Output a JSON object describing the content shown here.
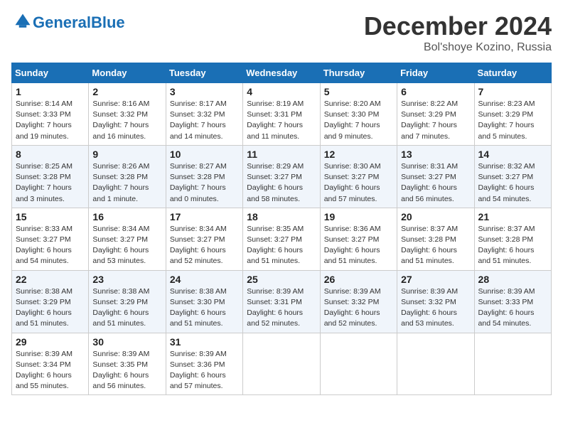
{
  "header": {
    "logo_text_general": "General",
    "logo_text_blue": "Blue",
    "month": "December 2024",
    "location": "Bol'shoye Kozino, Russia"
  },
  "days_of_week": [
    "Sunday",
    "Monday",
    "Tuesday",
    "Wednesday",
    "Thursday",
    "Friday",
    "Saturday"
  ],
  "weeks": [
    [
      {
        "day": "1",
        "sunrise": "Sunrise: 8:14 AM",
        "sunset": "Sunset: 3:33 PM",
        "daylight": "Daylight: 7 hours and 19 minutes."
      },
      {
        "day": "2",
        "sunrise": "Sunrise: 8:16 AM",
        "sunset": "Sunset: 3:32 PM",
        "daylight": "Daylight: 7 hours and 16 minutes."
      },
      {
        "day": "3",
        "sunrise": "Sunrise: 8:17 AM",
        "sunset": "Sunset: 3:32 PM",
        "daylight": "Daylight: 7 hours and 14 minutes."
      },
      {
        "day": "4",
        "sunrise": "Sunrise: 8:19 AM",
        "sunset": "Sunset: 3:31 PM",
        "daylight": "Daylight: 7 hours and 11 minutes."
      },
      {
        "day": "5",
        "sunrise": "Sunrise: 8:20 AM",
        "sunset": "Sunset: 3:30 PM",
        "daylight": "Daylight: 7 hours and 9 minutes."
      },
      {
        "day": "6",
        "sunrise": "Sunrise: 8:22 AM",
        "sunset": "Sunset: 3:29 PM",
        "daylight": "Daylight: 7 hours and 7 minutes."
      },
      {
        "day": "7",
        "sunrise": "Sunrise: 8:23 AM",
        "sunset": "Sunset: 3:29 PM",
        "daylight": "Daylight: 7 hours and 5 minutes."
      }
    ],
    [
      {
        "day": "8",
        "sunrise": "Sunrise: 8:25 AM",
        "sunset": "Sunset: 3:28 PM",
        "daylight": "Daylight: 7 hours and 3 minutes."
      },
      {
        "day": "9",
        "sunrise": "Sunrise: 8:26 AM",
        "sunset": "Sunset: 3:28 PM",
        "daylight": "Daylight: 7 hours and 1 minute."
      },
      {
        "day": "10",
        "sunrise": "Sunrise: 8:27 AM",
        "sunset": "Sunset: 3:28 PM",
        "daylight": "Daylight: 7 hours and 0 minutes."
      },
      {
        "day": "11",
        "sunrise": "Sunrise: 8:29 AM",
        "sunset": "Sunset: 3:27 PM",
        "daylight": "Daylight: 6 hours and 58 minutes."
      },
      {
        "day": "12",
        "sunrise": "Sunrise: 8:30 AM",
        "sunset": "Sunset: 3:27 PM",
        "daylight": "Daylight: 6 hours and 57 minutes."
      },
      {
        "day": "13",
        "sunrise": "Sunrise: 8:31 AM",
        "sunset": "Sunset: 3:27 PM",
        "daylight": "Daylight: 6 hours and 56 minutes."
      },
      {
        "day": "14",
        "sunrise": "Sunrise: 8:32 AM",
        "sunset": "Sunset: 3:27 PM",
        "daylight": "Daylight: 6 hours and 54 minutes."
      }
    ],
    [
      {
        "day": "15",
        "sunrise": "Sunrise: 8:33 AM",
        "sunset": "Sunset: 3:27 PM",
        "daylight": "Daylight: 6 hours and 54 minutes."
      },
      {
        "day": "16",
        "sunrise": "Sunrise: 8:34 AM",
        "sunset": "Sunset: 3:27 PM",
        "daylight": "Daylight: 6 hours and 53 minutes."
      },
      {
        "day": "17",
        "sunrise": "Sunrise: 8:34 AM",
        "sunset": "Sunset: 3:27 PM",
        "daylight": "Daylight: 6 hours and 52 minutes."
      },
      {
        "day": "18",
        "sunrise": "Sunrise: 8:35 AM",
        "sunset": "Sunset: 3:27 PM",
        "daylight": "Daylight: 6 hours and 51 minutes."
      },
      {
        "day": "19",
        "sunrise": "Sunrise: 8:36 AM",
        "sunset": "Sunset: 3:27 PM",
        "daylight": "Daylight: 6 hours and 51 minutes."
      },
      {
        "day": "20",
        "sunrise": "Sunrise: 8:37 AM",
        "sunset": "Sunset: 3:28 PM",
        "daylight": "Daylight: 6 hours and 51 minutes."
      },
      {
        "day": "21",
        "sunrise": "Sunrise: 8:37 AM",
        "sunset": "Sunset: 3:28 PM",
        "daylight": "Daylight: 6 hours and 51 minutes."
      }
    ],
    [
      {
        "day": "22",
        "sunrise": "Sunrise: 8:38 AM",
        "sunset": "Sunset: 3:29 PM",
        "daylight": "Daylight: 6 hours and 51 minutes."
      },
      {
        "day": "23",
        "sunrise": "Sunrise: 8:38 AM",
        "sunset": "Sunset: 3:29 PM",
        "daylight": "Daylight: 6 hours and 51 minutes."
      },
      {
        "day": "24",
        "sunrise": "Sunrise: 8:38 AM",
        "sunset": "Sunset: 3:30 PM",
        "daylight": "Daylight: 6 hours and 51 minutes."
      },
      {
        "day": "25",
        "sunrise": "Sunrise: 8:39 AM",
        "sunset": "Sunset: 3:31 PM",
        "daylight": "Daylight: 6 hours and 52 minutes."
      },
      {
        "day": "26",
        "sunrise": "Sunrise: 8:39 AM",
        "sunset": "Sunset: 3:32 PM",
        "daylight": "Daylight: 6 hours and 52 minutes."
      },
      {
        "day": "27",
        "sunrise": "Sunrise: 8:39 AM",
        "sunset": "Sunset: 3:32 PM",
        "daylight": "Daylight: 6 hours and 53 minutes."
      },
      {
        "day": "28",
        "sunrise": "Sunrise: 8:39 AM",
        "sunset": "Sunset: 3:33 PM",
        "daylight": "Daylight: 6 hours and 54 minutes."
      }
    ],
    [
      {
        "day": "29",
        "sunrise": "Sunrise: 8:39 AM",
        "sunset": "Sunset: 3:34 PM",
        "daylight": "Daylight: 6 hours and 55 minutes."
      },
      {
        "day": "30",
        "sunrise": "Sunrise: 8:39 AM",
        "sunset": "Sunset: 3:35 PM",
        "daylight": "Daylight: 6 hours and 56 minutes."
      },
      {
        "day": "31",
        "sunrise": "Sunrise: 8:39 AM",
        "sunset": "Sunset: 3:36 PM",
        "daylight": "Daylight: 6 hours and 57 minutes."
      },
      null,
      null,
      null,
      null
    ]
  ]
}
